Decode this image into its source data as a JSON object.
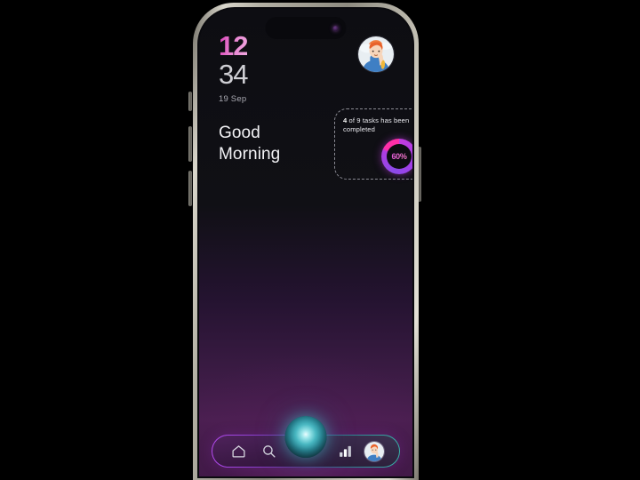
{
  "device": {
    "frame_color": "#b3b0a4",
    "screen_bg_top": "#0d0d12",
    "screen_bg_bottom": "#4a1f50",
    "island_camera_color": "#6c3d86"
  },
  "status": {
    "clock_hour": "12",
    "clock_minute": "34",
    "date": "19 Sep",
    "hour_color": "#d83bb5",
    "minute_color": "#cfcfd4"
  },
  "greeting": {
    "line1": "Good",
    "line2": "Morning"
  },
  "profile": {
    "avatar_name": "user-avatar-illustration"
  },
  "task_widget": {
    "prefix_count": "4",
    "text_rest": " of 9 tasks has been completed",
    "full_text": "4 of 9 tasks has been completed",
    "completed": 4,
    "total": 9,
    "percent_label": "60%",
    "percent_value": 60,
    "ring_color": "#b03ce0",
    "ring_accent_color": "#ff2fa8",
    "border_style": "dashed"
  },
  "bottom_nav": {
    "items": [
      {
        "id": "home",
        "icon": "home-icon",
        "label": "Home"
      },
      {
        "id": "search",
        "icon": "search-icon",
        "label": "Search"
      },
      {
        "id": "assistant",
        "icon": "orb-icon",
        "label": "Assistant"
      },
      {
        "id": "stats",
        "icon": "bar-chart-icon",
        "label": "Stats"
      },
      {
        "id": "profile",
        "icon": "avatar-icon",
        "label": "Profile"
      }
    ],
    "border_gradient_start": "#b44bf0",
    "border_gradient_end": "#37b2a8",
    "orb_color": "#49b8c2"
  }
}
